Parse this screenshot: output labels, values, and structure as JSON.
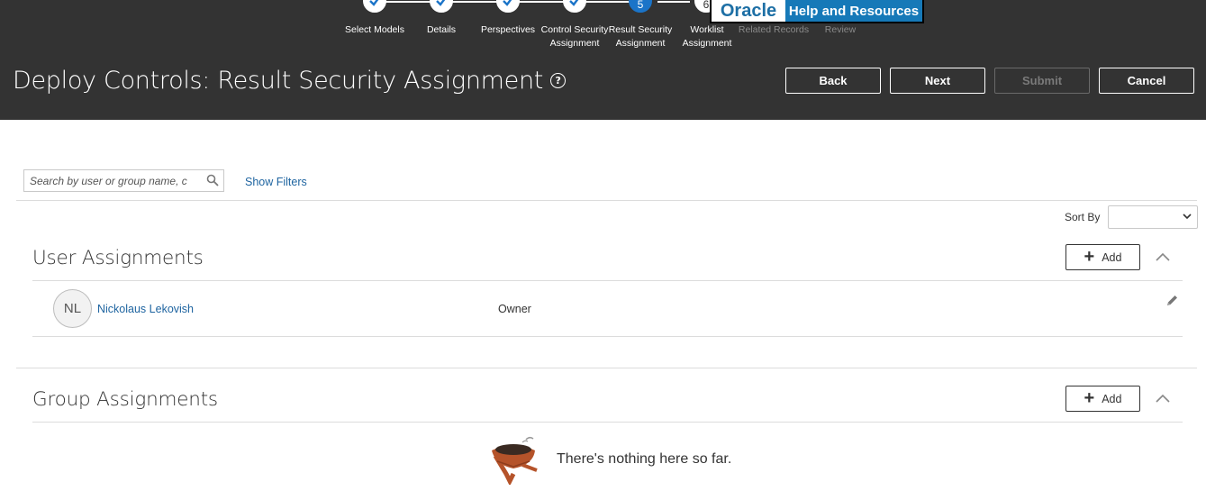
{
  "train": {
    "steps": [
      {
        "label": "Select Models",
        "state": "done"
      },
      {
        "label": "Details",
        "state": "done"
      },
      {
        "label": "Perspectives",
        "state": "done"
      },
      {
        "label": "Control Security\nAssignment",
        "state": "done"
      },
      {
        "label": "Result Security\nAssignment",
        "state": "current",
        "number": "5"
      },
      {
        "label": "Worklist\nAssignment",
        "state": "next",
        "number": "6"
      },
      {
        "label": "Related Records",
        "state": "disabled"
      },
      {
        "label": "Review",
        "state": "disabled"
      }
    ]
  },
  "oracle_badge": {
    "left": "Oracle",
    "right": "Help and Resources"
  },
  "header": {
    "title": "Deploy Controls: Result Security Assignment",
    "help_icon": "?",
    "buttons": {
      "back": "Back",
      "next": "Next",
      "submit": "Submit",
      "cancel": "Cancel"
    }
  },
  "search": {
    "placeholder": "Search by user or group name, c"
  },
  "filters": {
    "show_label": "Show Filters"
  },
  "sort": {
    "label": "Sort By",
    "value": ""
  },
  "user_assignments": {
    "title": "User Assignments",
    "add_label": "Add",
    "rows": [
      {
        "initials": "NL",
        "name": "Nickolaus Lekovish",
        "role": "Owner"
      }
    ]
  },
  "group_assignments": {
    "title": "Group Assignments",
    "add_label": "Add",
    "empty_text": "There's nothing here so far."
  },
  "colors": {
    "header_bg": "#333333",
    "accent": "#1b74c8",
    "link": "#1e64a0"
  }
}
